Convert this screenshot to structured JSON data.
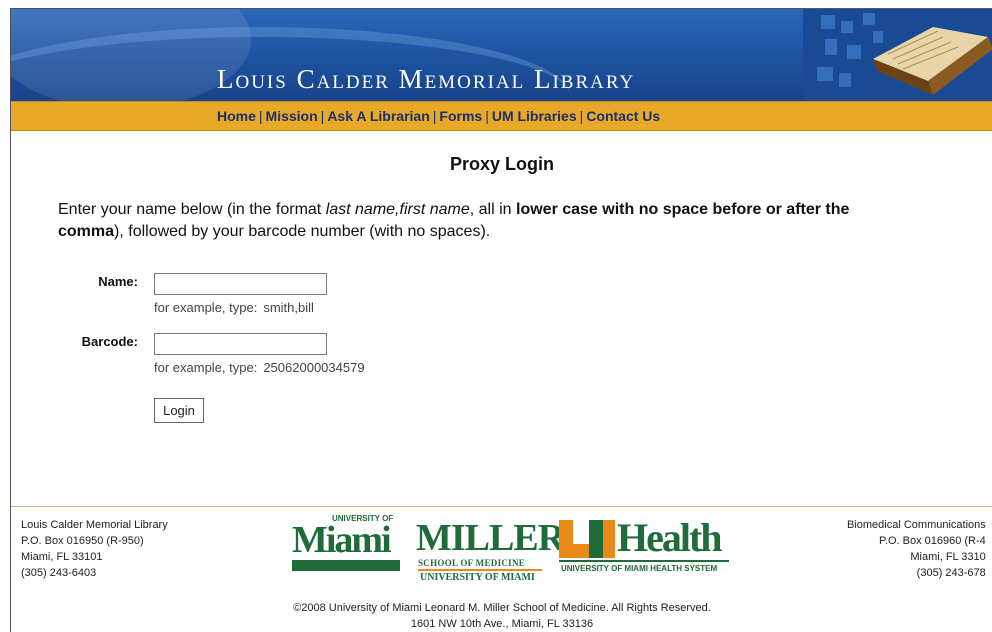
{
  "header": {
    "title": "Louis Calder Memorial Library"
  },
  "nav": {
    "items": [
      {
        "label": "Home"
      },
      {
        "label": "Mission"
      },
      {
        "label": "Ask A Librarian"
      },
      {
        "label": "Forms"
      },
      {
        "label": "UM Libraries"
      },
      {
        "label": "Contact Us"
      }
    ],
    "separator": "|"
  },
  "main": {
    "page_title": "Proxy Login",
    "instructions": {
      "part1": "Enter your name below (in the format ",
      "italic": "last name,first name",
      "part2": ", all in ",
      "bold1": "lower case with no space before or after the",
      "bold2": "comma",
      "part3": "), followed by your barcode number (with no spaces)."
    },
    "form": {
      "name_label": "Name:",
      "name_value": "",
      "name_hint_prefix": "for example, type:",
      "name_hint_example": "smith,bill",
      "barcode_label": "Barcode:",
      "barcode_value": "",
      "barcode_hint_prefix": "for example, type:",
      "barcode_hint_example": "25062000034579",
      "login_label": "Login"
    }
  },
  "footer": {
    "left": {
      "line1": "Louis Calder Memorial Library",
      "line2": "P.O. Box 016950 (R-950)",
      "line3": "Miami, FL 33101",
      "line4": "(305) 243-6403"
    },
    "right": {
      "line1": "Biomedical Communications",
      "line2": "P.O. Box 016960 (R-4",
      "line3": "Miami, FL 3310",
      "line4": "(305) 243-678"
    },
    "logos": {
      "miami_top": "UNIVERSITY OF",
      "miami_word": "Miami",
      "miller_word": "MILLER",
      "miller_school": "SCHOOL OF MEDICINE",
      "miller_um": "UNIVERSITY OF MIAMI",
      "uhealth_word": "Health",
      "uhealth_system": "UNIVERSITY OF MIAMI HEALTH SYSTEM"
    },
    "copyright_line1": "©2008 University of Miami Leonard M. Miller School of Medicine. All Rights Reserved.",
    "copyright_line2": "1601 NW 10th Ave., Miami, FL 33136"
  },
  "colors": {
    "banner_blue": "#1f55a4",
    "nav_gold": "#e9a928",
    "nav_text": "#1c2f6b",
    "um_green": "#1f6b3a",
    "um_orange": "#e98a1a"
  }
}
